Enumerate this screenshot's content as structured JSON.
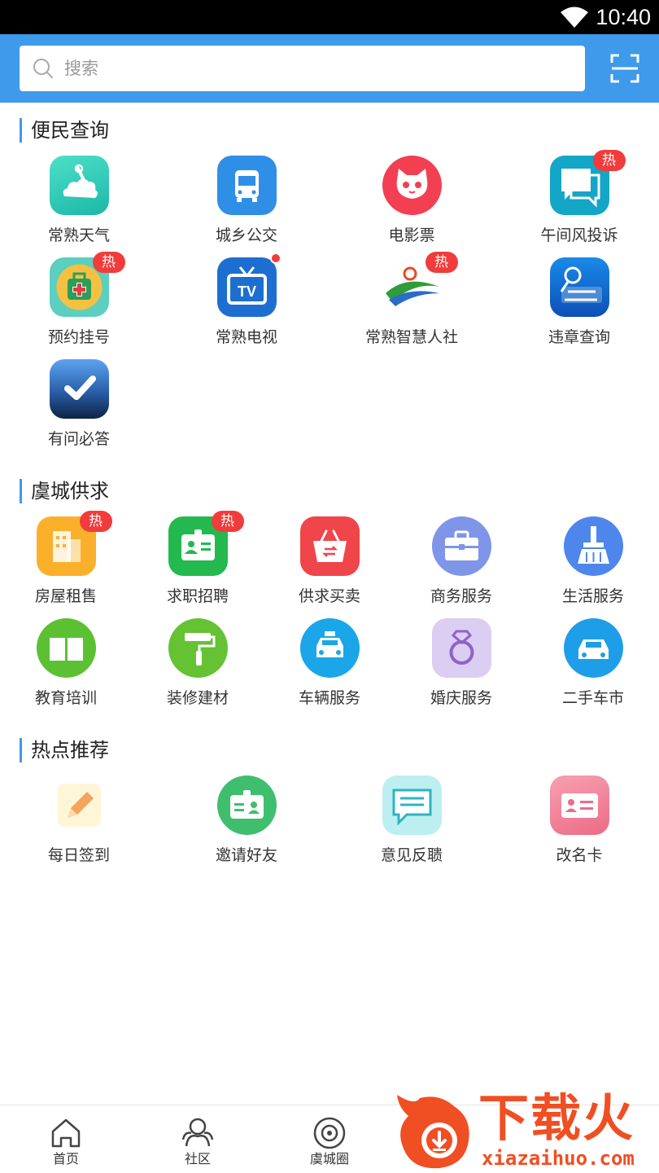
{
  "status_bar": {
    "time": "10:40",
    "wifi_icon": "wifi-icon"
  },
  "header": {
    "search_placeholder": "搜索",
    "scan_icon": "scan-icon",
    "bg_color": "#3e9aea"
  },
  "sections": {
    "convenience": {
      "title": "便民查询",
      "items": [
        {
          "label": "常熟天气",
          "icon": "weather-icon"
        },
        {
          "label": "城乡公交",
          "icon": "bus-icon"
        },
        {
          "label": "电影票",
          "icon": "movie-cat-icon"
        },
        {
          "label": "午间风投诉",
          "icon": "chat-bubbles-icon",
          "badge": "热"
        },
        {
          "label": "预约挂号",
          "icon": "medical-kit-icon",
          "badge": "热"
        },
        {
          "label": "常熟电视",
          "icon": "tv-icon"
        },
        {
          "label": "常熟智慧人社",
          "icon": "social-security-logo",
          "badge": "热"
        },
        {
          "label": "违章查询",
          "icon": "violation-icon"
        },
        {
          "label": "有问必答",
          "icon": "checkmark-icon"
        }
      ]
    },
    "supply": {
      "title": "虞城供求",
      "items": [
        {
          "label": "房屋租售",
          "icon": "building-icon",
          "badge": "热"
        },
        {
          "label": "求职招聘",
          "icon": "id-card-icon",
          "badge": "热"
        },
        {
          "label": "供求买卖",
          "icon": "basket-icon"
        },
        {
          "label": "商务服务",
          "icon": "briefcase-icon"
        },
        {
          "label": "生活服务",
          "icon": "broom-icon"
        },
        {
          "label": "教育培训",
          "icon": "book-icon"
        },
        {
          "label": "装修建材",
          "icon": "paint-roller-icon"
        },
        {
          "label": "车辆服务",
          "icon": "taxi-icon"
        },
        {
          "label": "婚庆服务",
          "icon": "ring-icon"
        },
        {
          "label": "二手车市",
          "icon": "car-icon"
        }
      ]
    },
    "hot": {
      "title": "热点推荐",
      "items": [
        {
          "label": "每日签到",
          "icon": "pencil-icon"
        },
        {
          "label": "邀请好友",
          "icon": "invite-card-icon"
        },
        {
          "label": "意见反聩",
          "icon": "feedback-icon"
        },
        {
          "label": "改名卡",
          "icon": "name-card-icon"
        }
      ]
    }
  },
  "bottom_nav": [
    {
      "label": "首页",
      "icon": "home-icon"
    },
    {
      "label": "社区",
      "icon": "community-icon"
    },
    {
      "label": "虞城圈",
      "icon": "circle-icon"
    }
  ],
  "watermark": {
    "title": "下载火",
    "url": "xiazaihuo.com"
  }
}
